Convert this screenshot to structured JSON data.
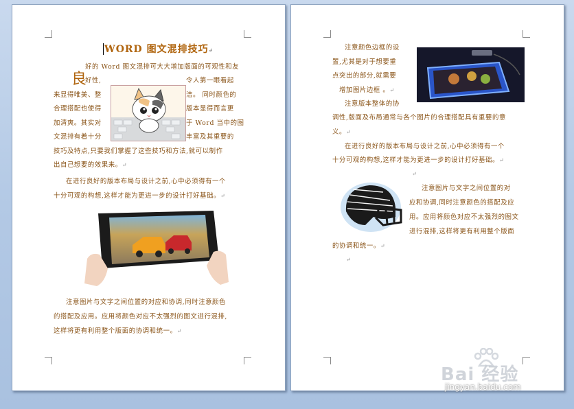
{
  "page1": {
    "title": "WORD 图文混排技巧",
    "drop_cap": "良",
    "p1_lines": [
      "好的 Word 图文混排可大大增加版面的可观性和友",
      "好性,",
      "令人第一眼看起",
      "来显得唯美、整",
      "洁。 同时颜色的",
      "合理搭配也使得",
      "版本显得而言更",
      "加清爽。其实对",
      "于 Word 当中的图",
      "文混排有着十分",
      "丰富及其重要的",
      "技巧及特点,只要我们掌握了这些技巧和方法,就可以制作",
      "出自己想要的效果来。"
    ],
    "p2_lines": [
      "在进行良好的版本布局与设计之前,心中必须得有一个",
      "十分可观的构想,这样才能为更进一步的设计打好基础。"
    ],
    "p3_lines": [
      "注意图片与文字之间位置的对应和协调,同时注意颜色",
      "的搭配及应用。应用将颜色对应不太强烈的图文进行混排,",
      "这样将更有利用整个版面的协调和统一。"
    ]
  },
  "page2": {
    "p1_lines": [
      "注意颜色边框的设",
      "置,尤其是对于想要重",
      "点突出的部分,就需要",
      "增加图片边框 。"
    ],
    "p2_lines": [
      "注意版本整体的协",
      "调性,版面及布局通常与各个图片的合理搭配具有重要的意",
      "义。"
    ],
    "p3_lines": [
      "在进行良好的版本布局与设计之前,心中必须得有一个",
      "十分可观的构想,这样才能为更进一步的设计打好基础。"
    ],
    "p4_lines": [
      "注意图片与文字之间位置的对",
      "应和协调,同时注意颜色的搭配及应",
      "用。应用将颜色对应不太强烈的图文",
      "进行混排,这样将更有利用整个版面",
      "的协调和统一。"
    ]
  },
  "watermark": {
    "brand": "Bai 经验",
    "url": "jingyan.baidu.com"
  },
  "colors": {
    "body_text": "#8a5418",
    "title": "#b0650f",
    "background": "#b3c9e5"
  }
}
